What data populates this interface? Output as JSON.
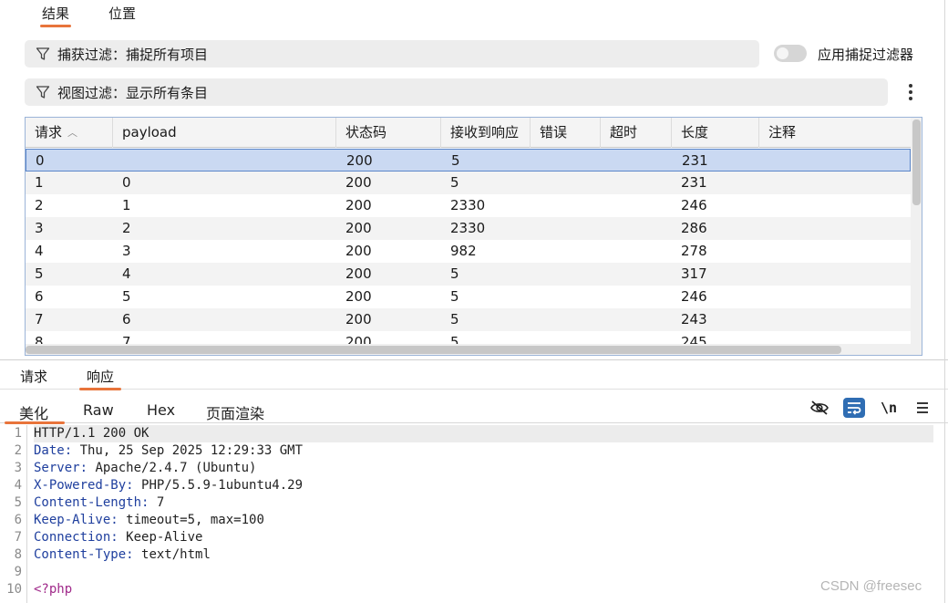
{
  "top_tabs": [
    "结果",
    "位置"
  ],
  "capture_filter": "捕获过滤：捕捉所有项目",
  "view_filter": "视图过滤：显示所有条目",
  "toggle_label": "应用捕捉过滤器",
  "toggle_on": false,
  "table": {
    "headers": [
      "请求",
      "payload",
      "状态码",
      "接收到响应",
      "错误",
      "超时",
      "长度",
      "注释"
    ],
    "rows": [
      [
        "0",
        "",
        "200",
        "5",
        "",
        "",
        "231",
        ""
      ],
      [
        "1",
        "0",
        "200",
        "5",
        "",
        "",
        "231",
        ""
      ],
      [
        "2",
        "1",
        "200",
        "2330",
        "",
        "",
        "246",
        ""
      ],
      [
        "3",
        "2",
        "200",
        "2330",
        "",
        "",
        "286",
        ""
      ],
      [
        "4",
        "3",
        "200",
        "982",
        "",
        "",
        "278",
        ""
      ],
      [
        "5",
        "4",
        "200",
        "5",
        "",
        "",
        "317",
        ""
      ],
      [
        "6",
        "5",
        "200",
        "5",
        "",
        "",
        "246",
        ""
      ],
      [
        "7",
        "6",
        "200",
        "5",
        "",
        "",
        "243",
        ""
      ],
      [
        "8",
        "7",
        "200",
        "5",
        "",
        "",
        "245",
        ""
      ]
    ],
    "selected_row": 0
  },
  "sub_tabs": [
    "请求",
    "响应"
  ],
  "view_tabs": [
    "美化",
    "Raw",
    "Hex",
    "页面渲染"
  ],
  "toolbar": {
    "newline_label": "\\n",
    "icons": [
      "eye-off-icon",
      "wrap-icon",
      "newline-icon",
      "menu-icon"
    ]
  },
  "response_lines": [
    {
      "num": "1",
      "key": "",
      "sep": "",
      "val": "HTTP/1.1 200 OK"
    },
    {
      "num": "2",
      "key": "Date",
      "sep": ": ",
      "val": "Thu, 25 Sep 2025 12:29:33 GMT"
    },
    {
      "num": "3",
      "key": "Server",
      "sep": ": ",
      "val": "Apache/2.4.7 (Ubuntu)"
    },
    {
      "num": "4",
      "key": "X-Powered-By",
      "sep": ": ",
      "val": "PHP/5.5.9-1ubuntu4.29"
    },
    {
      "num": "5",
      "key": "Content-Length",
      "sep": ": ",
      "val": "7"
    },
    {
      "num": "6",
      "key": "Keep-Alive",
      "sep": ": ",
      "val": "timeout=5, max=100"
    },
    {
      "num": "7",
      "key": "Connection",
      "sep": ": ",
      "val": "Keep-Alive"
    },
    {
      "num": "8",
      "key": "Content-Type",
      "sep": ": ",
      "val": "text/html"
    },
    {
      "num": "9",
      "key": "",
      "sep": "",
      "val": ""
    },
    {
      "num": "10",
      "key": "",
      "sep": "",
      "val": "<?php"
    }
  ],
  "watermark": "CSDN @freesec",
  "colors": {
    "accent": "#e8743b",
    "selected_row": "#cad9f2",
    "header_key": "#1f3f9e"
  }
}
